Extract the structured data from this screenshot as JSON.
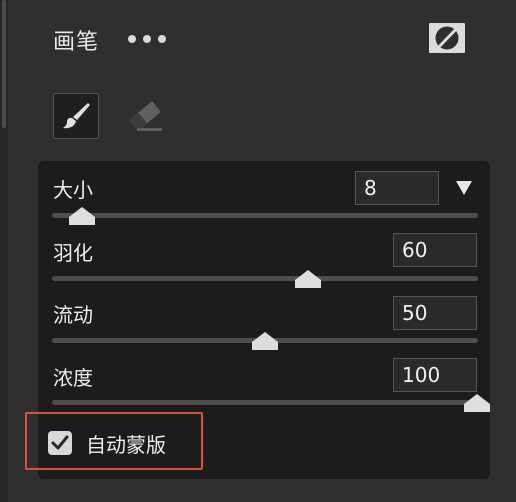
{
  "header": {
    "title": "画笔",
    "more_icon": "more-horizontal-icon",
    "mask_icon": "mask-visibility-off-icon"
  },
  "tools": [
    {
      "name": "brush",
      "icon": "brush-icon",
      "selected": true
    },
    {
      "name": "eraser",
      "icon": "eraser-icon",
      "selected": false
    }
  ],
  "controls": {
    "size": {
      "label": "大小",
      "value": "8",
      "level": 0.07
    },
    "feather": {
      "label": "羽化",
      "value": "60",
      "level": 0.6
    },
    "flow": {
      "label": "流动",
      "value": "50",
      "level": 0.5
    },
    "density": {
      "label": "浓度",
      "value": "100",
      "level": 1.0
    }
  },
  "auto_mask": {
    "label": "自动蒙版",
    "checked": true
  },
  "colors": {
    "background": "#2f2f2f",
    "panel": "#1c1c1c",
    "highlight": "#d4553a"
  }
}
